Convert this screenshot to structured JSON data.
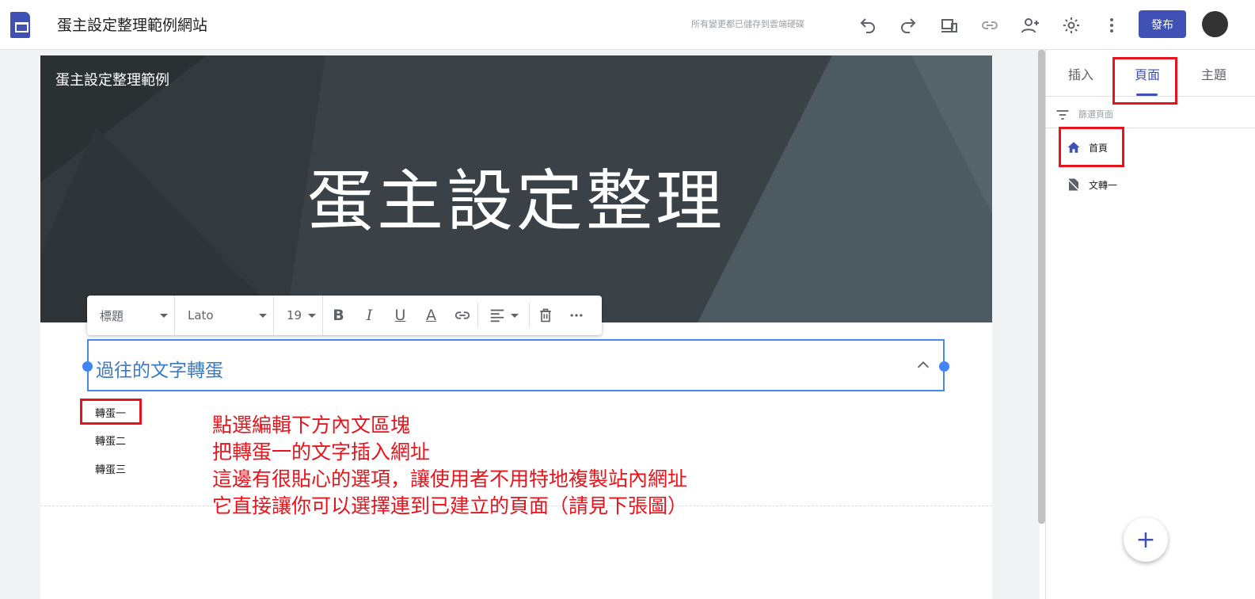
{
  "header": {
    "site_title": "蛋主設定整理範例網站",
    "save_status": "所有變更都已儲存到雲端硬碟",
    "publish_label": "發布",
    "icons": [
      "undo-icon",
      "redo-icon",
      "preview-icon",
      "link-icon",
      "share-icon",
      "settings-icon",
      "more-vert-icon"
    ]
  },
  "banner": {
    "site_name": "蛋主設定整理範例",
    "title": "蛋主設定整理"
  },
  "format_toolbar": {
    "style": "標題",
    "font": "Lato",
    "size": "19",
    "buttons": [
      "bold",
      "italic",
      "underline",
      "text-color",
      "link",
      "align",
      "delete",
      "more"
    ]
  },
  "editor": {
    "heading_text": "過往的文字轉蛋"
  },
  "toc": {
    "items": [
      "轉蛋一",
      "轉蛋二",
      "轉蛋三"
    ]
  },
  "annotation": {
    "lines": [
      "點選編輯下方內文區塊",
      "把轉蛋一的文字插入網址",
      "這邊有很貼心的選項，讓使用者不用特地複製站內網址",
      "它直接讓你可以選擇連到已建立的頁面（請見下張圖）"
    ],
    "color": "#e8141c"
  },
  "sidebar": {
    "tabs": [
      "插入",
      "頁面",
      "主題"
    ],
    "active_tab": "頁面",
    "filter_placeholder": "篩選頁面",
    "pages": [
      {
        "label": "首頁",
        "icon": "home-icon"
      },
      {
        "label": "文轉一",
        "icon": "hidden-page-icon"
      }
    ],
    "fab_label": "+"
  },
  "colors": {
    "accent": "#3f51b5",
    "selection": "#4a8ae0",
    "banner": "#3a4247"
  }
}
